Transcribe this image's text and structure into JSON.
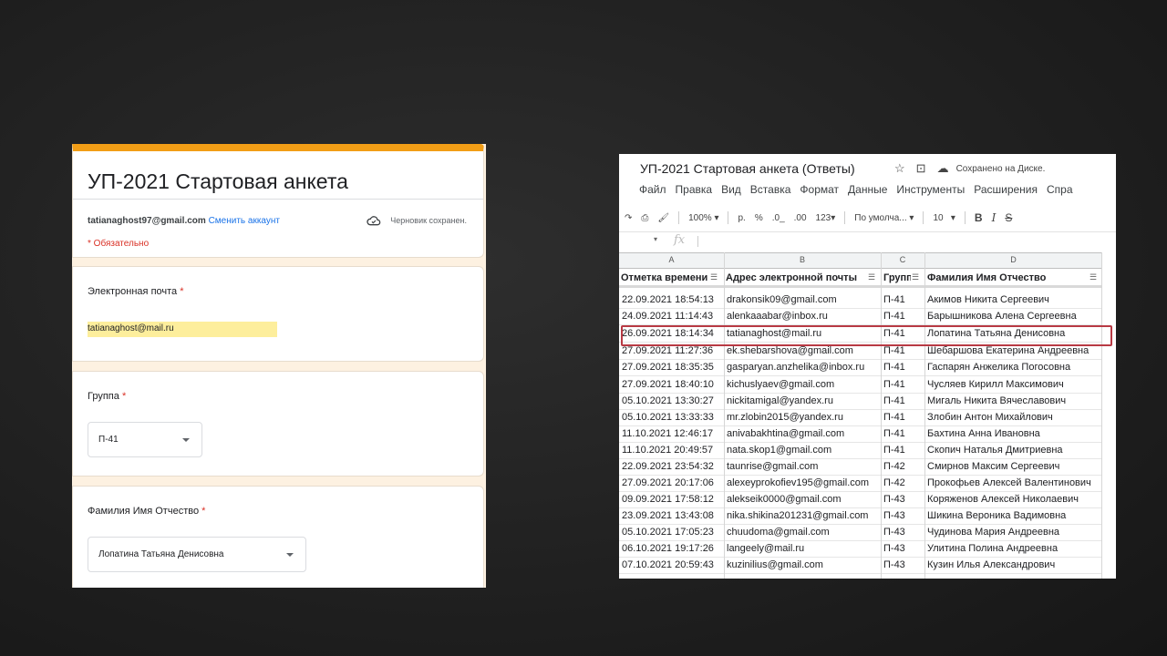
{
  "form": {
    "title": "УП-2021 Стартовая анкета",
    "account_email": "tatianaghost97@gmail.com",
    "switch_account": "Сменить аккаунт",
    "draft_status": "Черновик сохранен.",
    "required_note": "* Обязательно",
    "questions": {
      "email": {
        "label": "Электронная почта",
        "required": "*",
        "value": "tatianaghost@mail.ru"
      },
      "group": {
        "label": "Группа",
        "required": "*",
        "value": "П-41"
      },
      "fio": {
        "label": "Фамилия Имя Отчество",
        "required": "*",
        "value": "Лопатина Татьяна Денисовна"
      }
    },
    "accent_color": "#f29e16"
  },
  "sheet": {
    "title": "УП-2021 Стартовая анкета (Ответы)",
    "saved": "Сохранено на Диске.",
    "menu": [
      "Файл",
      "Правка",
      "Вид",
      "Вставка",
      "Формат",
      "Данные",
      "Инструменты",
      "Расширения",
      "Спра"
    ],
    "toolbar": {
      "zoom": "100%",
      "currency": "р.",
      "percent": "%",
      "dec_less": ".0_",
      "dec_more": ".00",
      "format": "123▾",
      "font": "По умолча...",
      "size": "10",
      "bold": "B",
      "italic": "I",
      "strike": "S"
    },
    "fx": "fx",
    "columns": [
      "A",
      "B",
      "C",
      "D"
    ],
    "headers": [
      "Отметка времени",
      "Адрес электронной почты",
      "Группа",
      "Фамилия Имя Отчество"
    ],
    "rows": [
      [
        "22.09.2021 18:54:13",
        "drakonsik09@gmail.com",
        "П-41",
        "Акимов Никита Сергеевич"
      ],
      [
        "24.09.2021 11:14:43",
        "alenkaaabar@inbox.ru",
        "П-41",
        "Барышникова Алена Сергеевна"
      ],
      [
        "26.09.2021 18:14:34",
        "tatianaghost@mail.ru",
        "П-41",
        "Лопатина Татьяна Денисовна"
      ],
      [
        "27.09.2021 11:27:36",
        "ek.shebarshova@gmail.com",
        "П-41",
        "Шебаршова Екатерина Андреевна"
      ],
      [
        "27.09.2021 18:35:35",
        "gasparyan.anzhelika@inbox.ru",
        "П-41",
        "Гаспарян Анжелика Погосовна"
      ],
      [
        "27.09.2021 18:40:10",
        "kichuslyaev@gmail.com",
        "П-41",
        "Чусляев Кирилл Максимович"
      ],
      [
        "05.10.2021 13:30:27",
        "nickitamigal@yandex.ru",
        "П-41",
        "Мигаль Никита Вячеславович"
      ],
      [
        "05.10.2021 13:33:33",
        "mr.zlobin2015@yandex.ru",
        "П-41",
        "Злобин Антон Михайлович"
      ],
      [
        "11.10.2021 12:46:17",
        "anivabakhtina@gmail.com",
        "П-41",
        "Бахтина Анна Ивановна"
      ],
      [
        "11.10.2021 20:49:57",
        "nata.skop1@gmail.com",
        "П-41",
        "Скопич Наталья Дмитриевна"
      ],
      [
        "22.09.2021 23:54:32",
        "taunrise@gmail.com",
        "П-42",
        "Смирнов Максим Сергеевич"
      ],
      [
        "27.09.2021 20:17:06",
        "alexeyprokofiev195@gmail.com",
        "П-42",
        "Прокофьев Алексей Валентинович"
      ],
      [
        "09.09.2021 17:58:12",
        "alekseik0000@gmail.com",
        "П-43",
        "Коряженов Алексей Николаевич"
      ],
      [
        "23.09.2021 13:43:08",
        "nika.shikina201231@gmail.com",
        "П-43",
        "Шикина Вероника Вадимовна"
      ],
      [
        "05.10.2021 17:05:23",
        "chuudoma@gmail.com",
        "П-43",
        "Чудинова Мария Андреевна"
      ],
      [
        "06.10.2021 19:17:26",
        "langeely@mail.ru",
        "П-43",
        "Улитина Полина Андреевна"
      ],
      [
        "07.10.2021 20:59:43",
        "kuzinilius@gmail.com",
        "П-43",
        "Кузин Илья Александрович"
      ]
    ],
    "highlight_color": "#b83a44"
  }
}
